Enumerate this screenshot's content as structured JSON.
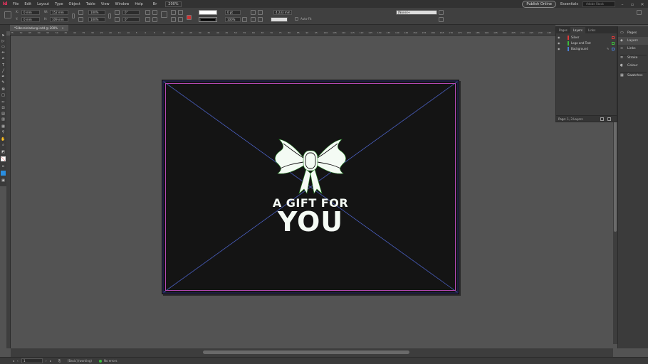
{
  "menubar": {
    "items": [
      "File",
      "Edit",
      "Layout",
      "Type",
      "Object",
      "Table",
      "View",
      "Window",
      "Help"
    ],
    "zoom": "200%",
    "publish_label": "Publish Online",
    "workspace": "Essentials",
    "search_placeholder": "Adobe Stock"
  },
  "control": {
    "x": "0 mm",
    "y": "0 mm",
    "w": "152 mm",
    "h": "109 mm",
    "scale_x": "100%",
    "scale_y": "100%",
    "angle": "0°",
    "shear": "0°",
    "stroke_weight": "0 pt",
    "opacity": "100%",
    "gap": "4.233 mm",
    "auto_fit_label": "Auto-Fit",
    "style_sel": "[None]+"
  },
  "tab": {
    "title": "*Silbereinladung.indd @ 200%"
  },
  "ruler_labels": [
    "75",
    "70",
    "65",
    "60",
    "55",
    "50",
    "45",
    "40",
    "35",
    "30",
    "25",
    "20",
    "15",
    "10",
    "5",
    "0",
    "5",
    "10",
    "15",
    "20",
    "25",
    "30",
    "35",
    "40",
    "45",
    "50",
    "55",
    "60",
    "65",
    "70",
    "75",
    "80",
    "85",
    "90",
    "95",
    "100",
    "105",
    "110",
    "115",
    "120",
    "125",
    "130",
    "135",
    "140",
    "145",
    "150",
    "155",
    "160",
    "165",
    "170",
    "175",
    "180",
    "185",
    "190",
    "195",
    "200",
    "205",
    "210",
    "215",
    "220",
    "225"
  ],
  "artwork": {
    "line1": "A GIFT FOR",
    "line2": "YOU"
  },
  "layers_panel": {
    "tabs": [
      "Pages",
      "Layers",
      "Links"
    ],
    "active_tab": "Layers",
    "layers": [
      {
        "name": "Silver",
        "color": "#e03a3a"
      },
      {
        "name": "Logo and Text",
        "color": "#3cbf3c"
      },
      {
        "name": "Background",
        "color": "#4a7fd6"
      }
    ],
    "footer": "Page: 1, 3 Layers"
  },
  "dock": {
    "items": [
      "Pages",
      "Layers",
      "Links",
      "Stroke",
      "Colour",
      "Swatches"
    ],
    "active": "Layers"
  },
  "status": {
    "page": "1",
    "master": "[Basic] (working)",
    "preflight": "No errors"
  },
  "colors": {
    "page_bg": "#141414",
    "margin_guide": "#b548b5",
    "diagonal": "#4a5fc0",
    "art": "#f4fbf4"
  }
}
